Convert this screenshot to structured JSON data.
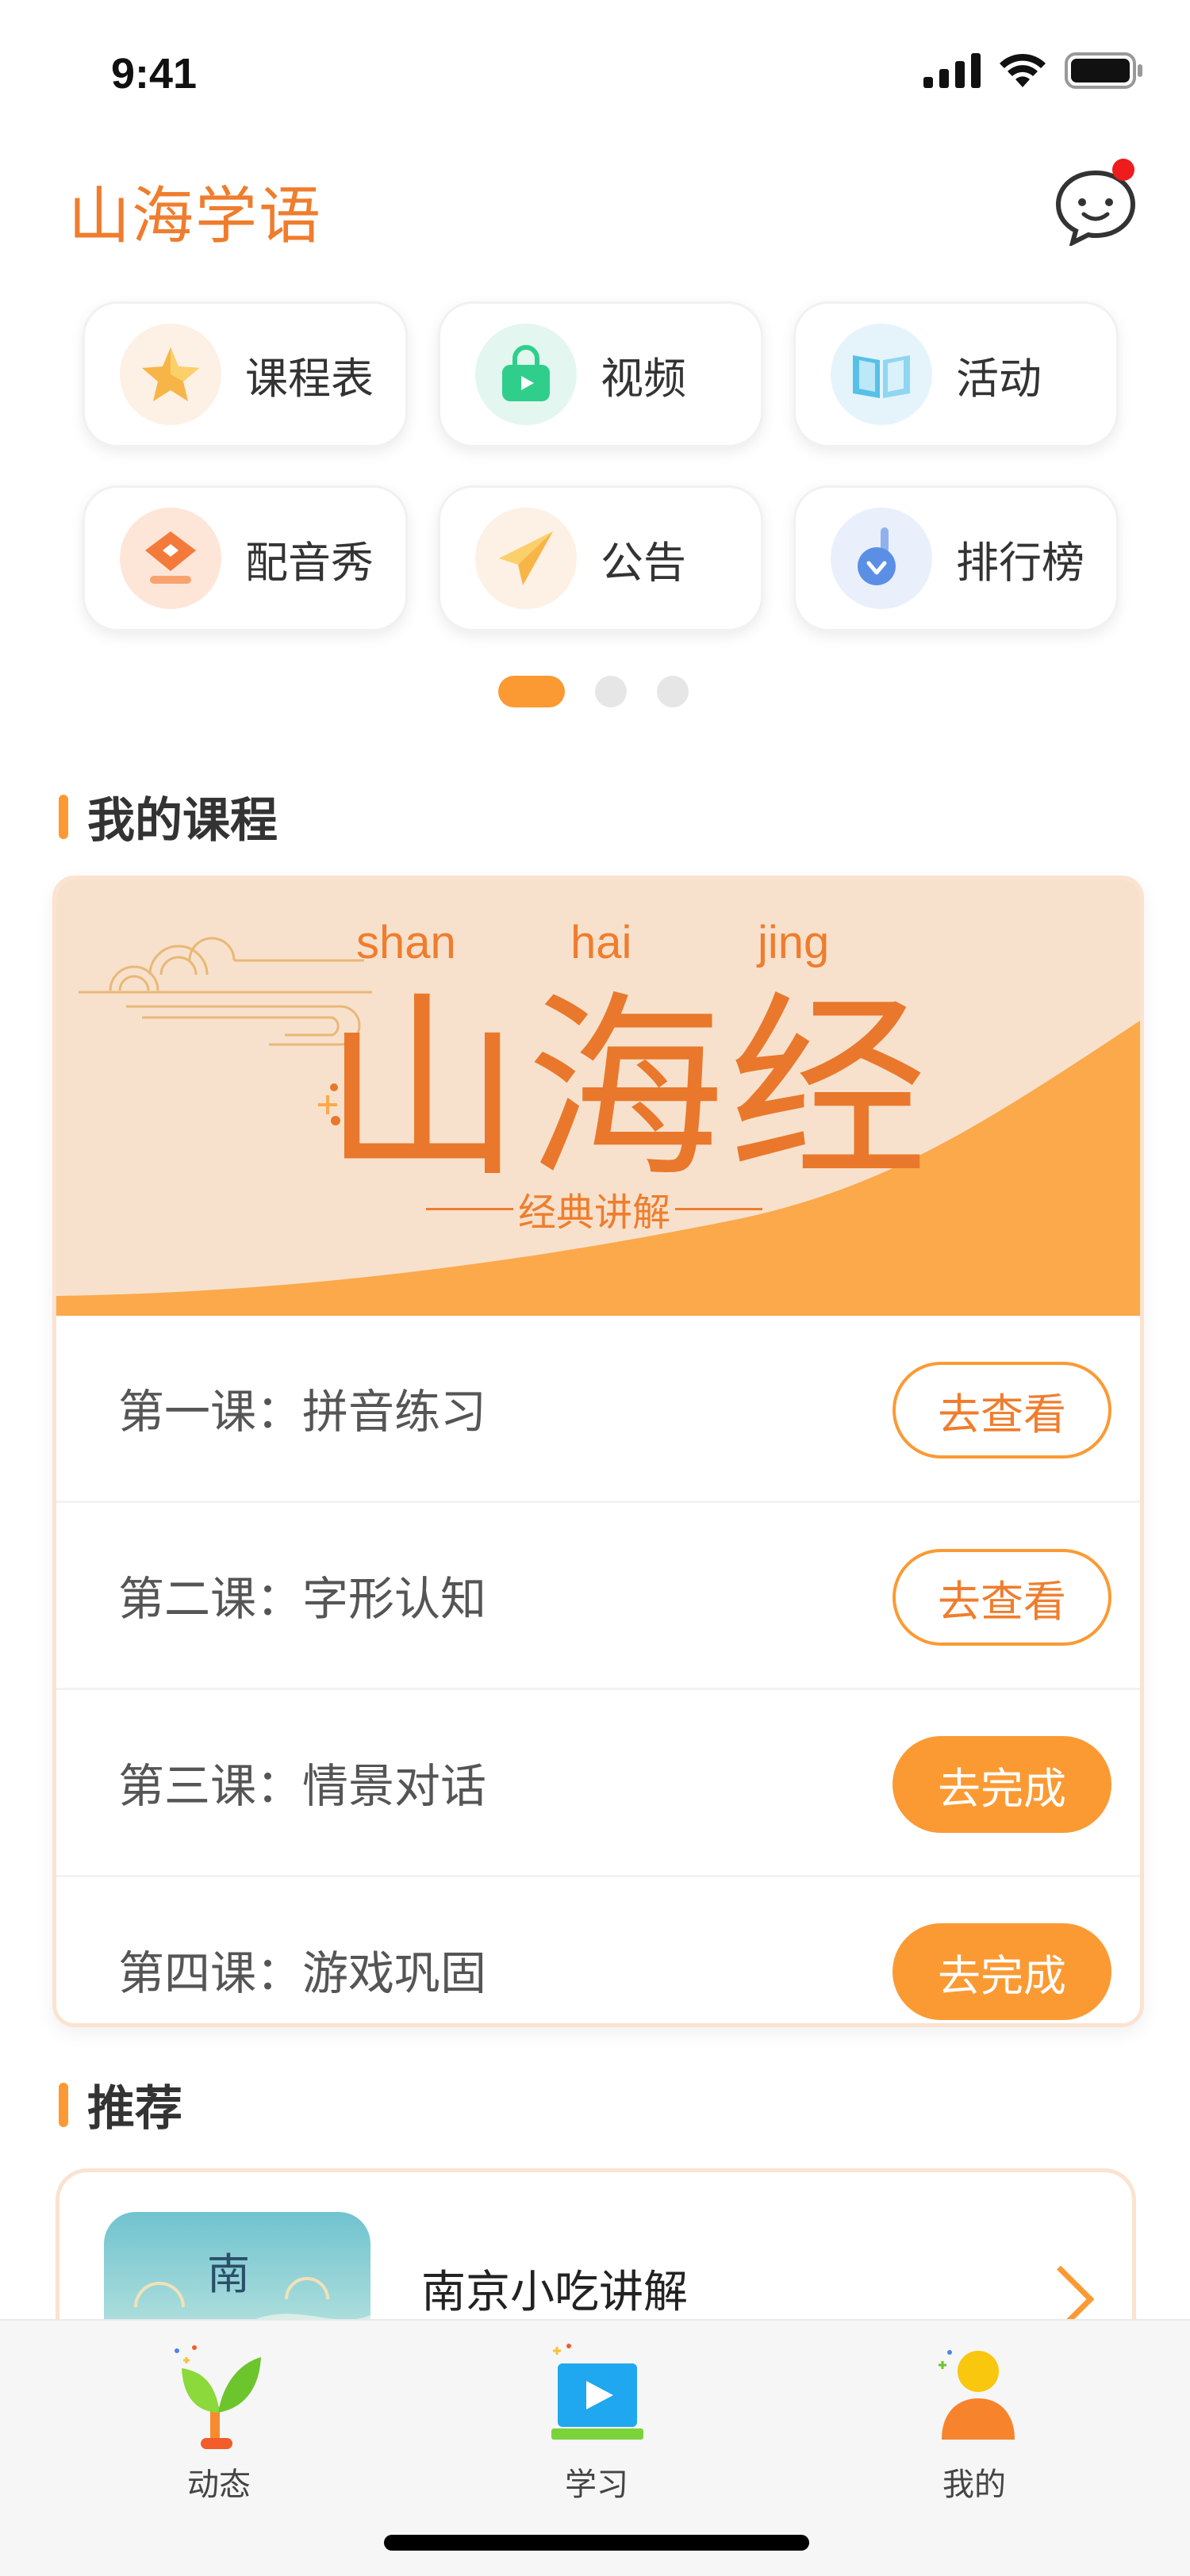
{
  "status": {
    "time": "9:41"
  },
  "header": {
    "title": "山海学语",
    "has_notification": true
  },
  "quick_entries": [
    {
      "label": "课程表",
      "icon": "star-icon",
      "bg": "#fdf0e4",
      "color": "#f8b547"
    },
    {
      "label": "视频",
      "icon": "video-bag-icon",
      "bg": "#e3f6ef",
      "color": "#2fcf8b"
    },
    {
      "label": "活动",
      "icon": "book-icon",
      "bg": "#e5f4fb",
      "color": "#57c0e8"
    },
    {
      "label": "配音秀",
      "icon": "dubbing-icon",
      "bg": "#fde6d8",
      "color": "#f47a3c"
    },
    {
      "label": "公告",
      "icon": "paper-plane-icon",
      "bg": "#fdf0e4",
      "color": "#f8b547"
    },
    {
      "label": "排行榜",
      "icon": "medal-icon",
      "bg": "#e9effb",
      "color": "#5b8fe6"
    }
  ],
  "pager": {
    "count": 3,
    "active": 0
  },
  "my_courses": {
    "section_title": "我的课程",
    "banner": {
      "pinyin": [
        "shan",
        "hai",
        "jing"
      ],
      "title": "山海经",
      "subtitle": "经典讲解"
    },
    "lessons": [
      {
        "name": "第一课：拼音练习",
        "action": "去查看",
        "style": "outline"
      },
      {
        "name": "第二课：字形认知",
        "action": "去查看",
        "style": "outline"
      },
      {
        "name": "第三课：情景对话",
        "action": "去完成",
        "style": "fill"
      },
      {
        "name": "第四课：游戏巩固",
        "action": "去完成",
        "style": "fill"
      }
    ]
  },
  "recommend": {
    "section_title": "推荐",
    "items": [
      {
        "title": "南京小吃讲解",
        "thumb_text": "南"
      }
    ]
  },
  "tabbar": {
    "tabs": [
      {
        "label": "动态",
        "icon": "sprout-icon"
      },
      {
        "label": "学习",
        "icon": "play-board-icon"
      },
      {
        "label": "我的",
        "icon": "user-icon"
      }
    ]
  },
  "colors": {
    "accent": "#fb9a33",
    "title": "#ef7d2d"
  }
}
